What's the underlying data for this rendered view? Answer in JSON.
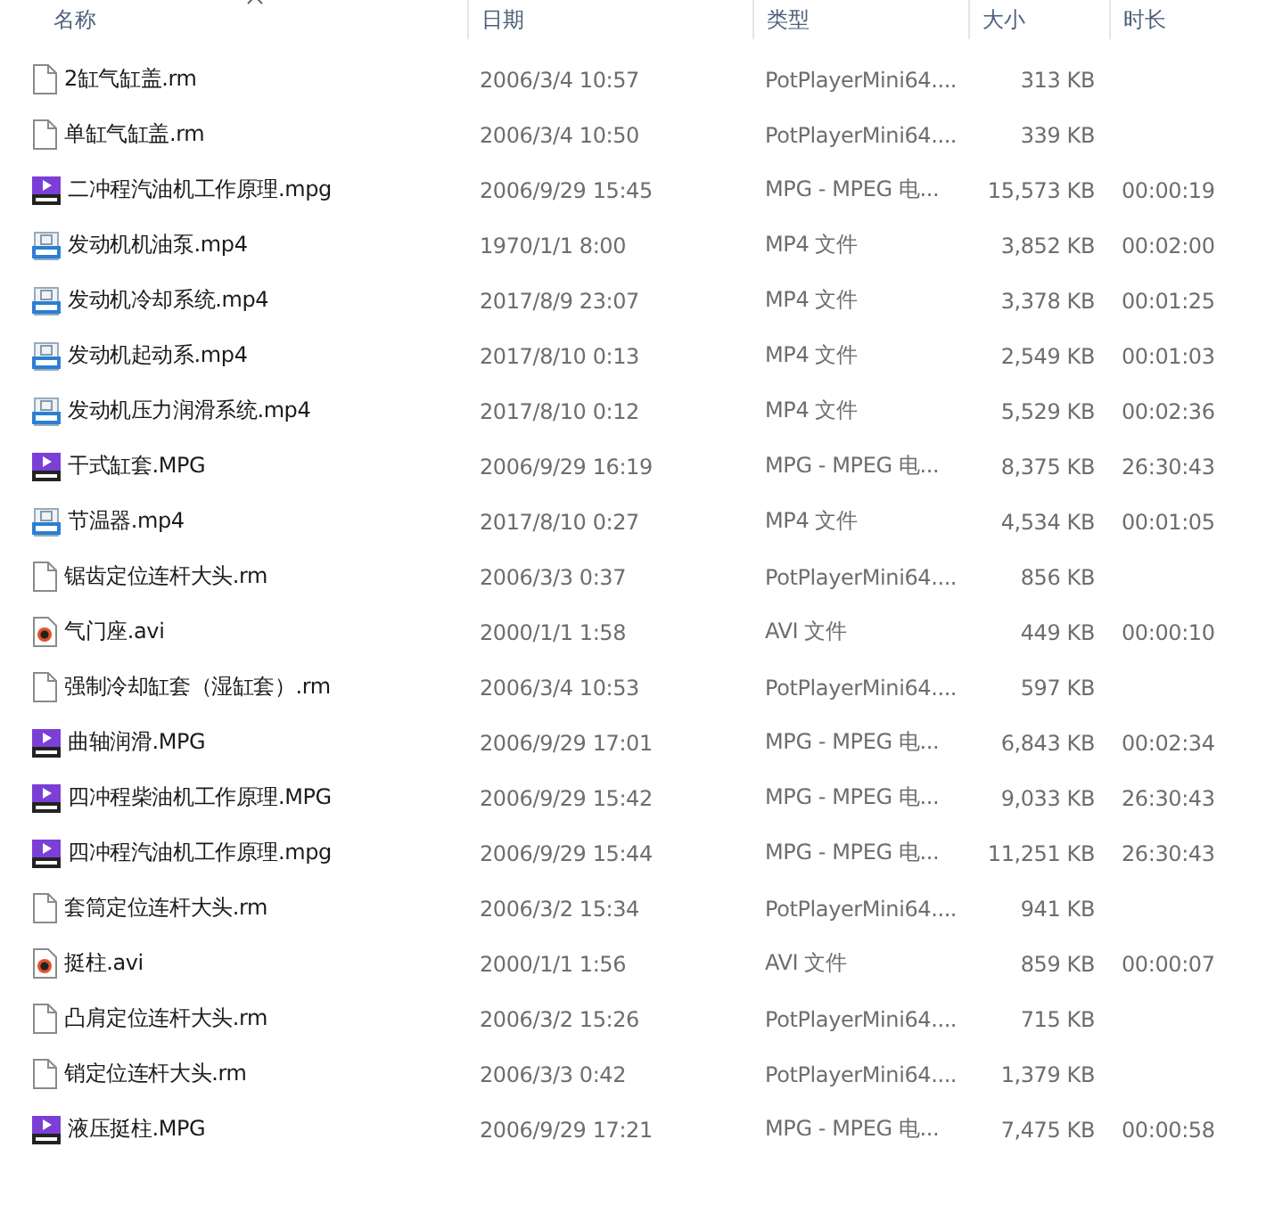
{
  "columns": [
    {
      "label": "名称",
      "sorted": true
    },
    {
      "label": "日期",
      "sorted": false
    },
    {
      "label": "类型",
      "sorted": false
    },
    {
      "label": "大小",
      "sorted": false
    },
    {
      "label": "时长",
      "sorted": false
    }
  ],
  "files": [
    {
      "kind": "doc",
      "name": "2缸气缸盖.rm",
      "date": "2006/3/4 10:57",
      "type": "PotPlayerMini64....",
      "size": "313 KB"
    },
    {
      "kind": "doc",
      "name": "单缸气缸盖.rm",
      "date": "2006/3/4 10:50",
      "type": "PotPlayerMini64....",
      "size": "339 KB"
    },
    {
      "kind": "mpg",
      "name": "二冲程汽油机工作原理.mpg",
      "date": "2006/9/29 15:45",
      "type": "MPG - MPEG 电...",
      "size": "15,573 KB",
      "duration": "00:00:19"
    },
    {
      "kind": "mp4",
      "name": "发动机机油泵.mp4",
      "date": "1970/1/1 8:00",
      "type": "MP4 文件",
      "size": "3,852 KB",
      "duration": "00:02:00"
    },
    {
      "kind": "mp4",
      "name": "发动机冷却系统.mp4",
      "date": "2017/8/9 23:07",
      "type": "MP4 文件",
      "size": "3,378 KB",
      "duration": "00:01:25"
    },
    {
      "kind": "mp4",
      "name": "发动机起动系.mp4",
      "date": "2017/8/10 0:13",
      "type": "MP4 文件",
      "size": "2,549 KB",
      "duration": "00:01:03"
    },
    {
      "kind": "mp4",
      "name": "发动机压力润滑系统.mp4",
      "date": "2017/8/10 0:12",
      "type": "MP4 文件",
      "size": "5,529 KB",
      "duration": "00:02:36"
    },
    {
      "kind": "mpg",
      "name": "干式缸套.MPG",
      "date": "2006/9/29 16:19",
      "type": "MPG - MPEG 电...",
      "size": "8,375 KB",
      "duration": "26:30:43"
    },
    {
      "kind": "mp4",
      "name": "节温器.mp4",
      "date": "2017/8/10 0:27",
      "type": "MP4 文件",
      "size": "4,534 KB",
      "duration": "00:01:05"
    },
    {
      "kind": "doc",
      "name": "锯齿定位连杆大头.rm",
      "date": "2006/3/3 0:37",
      "type": "PotPlayerMini64....",
      "size": "856 KB"
    },
    {
      "kind": "avi",
      "name": "气门座.avi",
      "date": "2000/1/1 1:58",
      "type": "AVI 文件",
      "size": "449 KB",
      "duration": "00:00:10"
    },
    {
      "kind": "doc",
      "name": "强制冷却缸套（湿缸套）.rm",
      "date": "2006/3/4 10:53",
      "type": "PotPlayerMini64....",
      "size": "597 KB"
    },
    {
      "kind": "mpg",
      "name": "曲轴润滑.MPG",
      "date": "2006/9/29 17:01",
      "type": "MPG - MPEG 电...",
      "size": "6,843 KB",
      "duration": "00:02:34"
    },
    {
      "kind": "mpg",
      "name": "四冲程柴油机工作原理.MPG",
      "date": "2006/9/29 15:42",
      "type": "MPG - MPEG 电...",
      "size": "9,033 KB",
      "duration": "26:30:43"
    },
    {
      "kind": "mpg",
      "name": "四冲程汽油机工作原理.mpg",
      "date": "2006/9/29 15:44",
      "type": "MPG - MPEG 电...",
      "size": "11,251 KB",
      "duration": "26:30:43"
    },
    {
      "kind": "doc",
      "name": "套筒定位连杆大头.rm",
      "date": "2006/3/2 15:34",
      "type": "PotPlayerMini64....",
      "size": "941 KB"
    },
    {
      "kind": "avi",
      "name": "挺柱.avi",
      "date": "2000/1/1 1:56",
      "type": "AVI 文件",
      "size": "859 KB",
      "duration": "00:00:07"
    },
    {
      "kind": "doc",
      "name": "凸肩定位连杆大头.rm",
      "date": "2006/3/2 15:26",
      "type": "PotPlayerMini64....",
      "size": "715 KB"
    },
    {
      "kind": "doc",
      "name": "销定位连杆大头.rm",
      "date": "2006/3/3 0:42",
      "type": "PotPlayerMini64....",
      "size": "1,379 KB"
    },
    {
      "kind": "mpg",
      "name": "液压挺柱.MPG",
      "date": "2006/9/29 17:21",
      "type": "MPG - MPEG 电...",
      "size": "7,475 KB",
      "duration": "00:00:58"
    }
  ]
}
